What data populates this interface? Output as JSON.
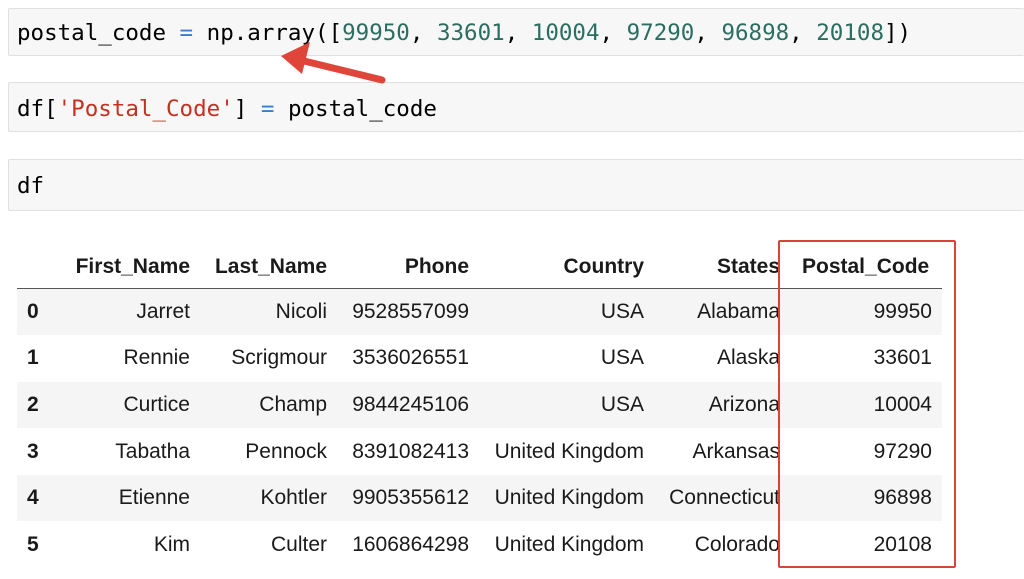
{
  "cells": {
    "cell1": {
      "var": "postal_code",
      "eq": " = ",
      "call": "np.array([",
      "values": [
        "99950",
        "33601",
        "10004",
        "97290",
        "96898",
        "20108"
      ],
      "close": "])"
    },
    "cell2": {
      "pre": "df[",
      "key": "'Postal_Code'",
      "post": "]",
      "eq": " = ",
      "rhs": "postal_code"
    },
    "cell3": {
      "code": "df"
    }
  },
  "table": {
    "columns": [
      "First_Name",
      "Last_Name",
      "Phone",
      "Country",
      "States",
      "Postal_Code"
    ],
    "rows": [
      {
        "index": "0",
        "first": "Jarret",
        "last": "Nicoli",
        "phone": "9528557099",
        "country": "USA",
        "state": "Alabama",
        "postal": "99950"
      },
      {
        "index": "1",
        "first": "Rennie",
        "last": "Scrigmour",
        "phone": "3536026551",
        "country": "USA",
        "state": "Alaska",
        "postal": "33601"
      },
      {
        "index": "2",
        "first": "Curtice",
        "last": "Champ",
        "phone": "9844245106",
        "country": "USA",
        "state": "Arizona",
        "postal": "10004"
      },
      {
        "index": "3",
        "first": "Tabatha",
        "last": "Pennock",
        "phone": "8391082413",
        "country": "United Kingdom",
        "state": "Arkansas",
        "postal": "97290"
      },
      {
        "index": "4",
        "first": "Etienne",
        "last": "Kohtler",
        "phone": "9905355612",
        "country": "United Kingdom",
        "state": "Connecticut",
        "postal": "96898"
      },
      {
        "index": "5",
        "first": "Kim",
        "last": "Culter",
        "phone": "1606864298",
        "country": "United Kingdom",
        "state": "Colorado",
        "postal": "20108"
      }
    ]
  },
  "annotations": {
    "highlight_color": "#d9443a",
    "arrow_color": "#e0453a"
  }
}
